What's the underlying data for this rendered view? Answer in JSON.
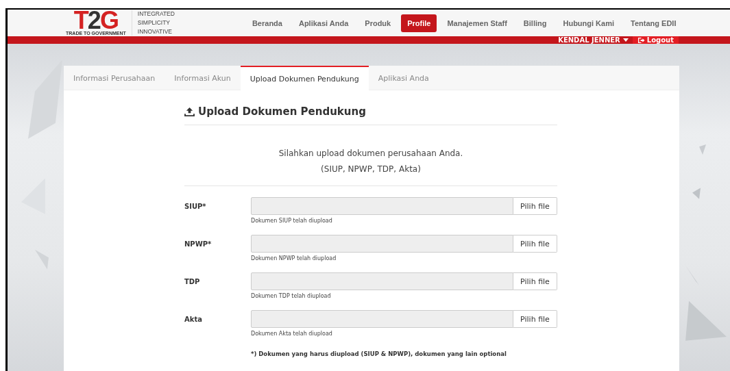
{
  "logo": {
    "letters": [
      {
        "text": "T",
        "kind": "red"
      },
      {
        "text": "2",
        "kind": "dark"
      },
      {
        "text": "G",
        "kind": "red"
      }
    ],
    "subtitle": "TRADE TO GOVERNMENT",
    "tagline": [
      "INTEGRATED",
      "SIMPLICITY",
      "INNOVATIVE"
    ]
  },
  "nav": [
    {
      "label": "Beranda",
      "selected": false
    },
    {
      "label": "Aplikasi Anda",
      "selected": false
    },
    {
      "label": "Produk",
      "selected": false
    },
    {
      "label": "Profile",
      "selected": true
    },
    {
      "label": "Manajemen Staff",
      "selected": false
    },
    {
      "label": "Billing",
      "selected": false
    },
    {
      "label": "Hubungi Kami",
      "selected": false
    },
    {
      "label": "Tentang EDII",
      "selected": false
    }
  ],
  "user_bar": {
    "user": "KENDAL JENNER",
    "logout": "Logout"
  },
  "tabs": [
    {
      "label": "Informasi Perusahaan",
      "selected": false
    },
    {
      "label": "Informasi Akun",
      "selected": false
    },
    {
      "label": "Upload Dokumen Pendukung",
      "selected": true
    },
    {
      "label": "Aplikasi Anda",
      "selected": false
    }
  ],
  "section": {
    "title": "Upload Dokumen Pendukung",
    "intro": [
      "Silahkan upload dokumen perusahaan Anda.",
      "(SIUP, NPWP, TDP, Akta)"
    ]
  },
  "fields": [
    {
      "label": "SIUP*",
      "button": "Pilih file",
      "hint": "Dokumen SIUP telah diupload"
    },
    {
      "label": "NPWP*",
      "button": "Pilih file",
      "hint": "Dokumen NPWP telah diupload"
    },
    {
      "label": "TDP",
      "button": "Pilih file",
      "hint": "Dokumen TDP telah diupload"
    },
    {
      "label": "Akta",
      "button": "Pilih file",
      "hint": "Dokumen Akta telah diupload"
    }
  ],
  "note": "*) Dokumen yang harus diupload (SIUP & NPWP), dokumen yang lain optional"
}
